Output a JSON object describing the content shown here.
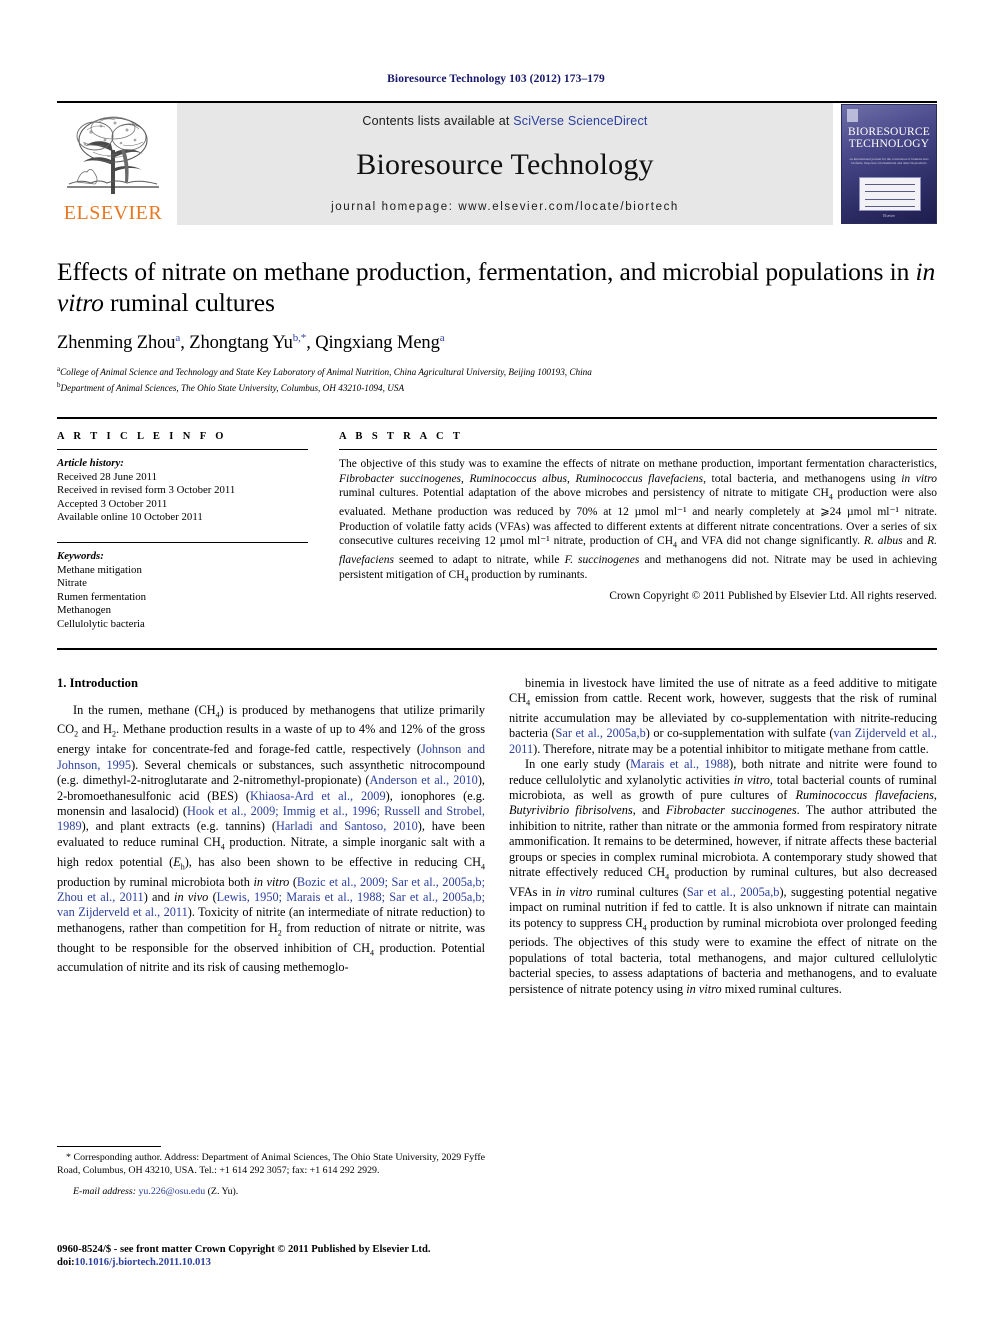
{
  "running_head": "Bioresource Technology 103 (2012) 173–179",
  "masthead": {
    "publisher_wordmark": "ELSEVIER",
    "contents_prefix": "Contents lists available at ",
    "contents_link": "SciVerse ScienceDirect",
    "journal_title": "Bioresource Technology",
    "homepage_label": "journal homepage: www.elsevier.com/locate/biortech",
    "cover_title_line1": "BIORESOURCE",
    "cover_title_line2": "TECHNOLOGY",
    "cover_subtitle": "an international journal for the conversion of biomass into biofuels, biopower, biochemicals and other bioproducts",
    "cover_footer": "Elsevier"
  },
  "article": {
    "title": "Effects of nitrate on methane production, fermentation, and microbial populations in in vitro ruminal cultures",
    "title_plain_1": "Effects of nitrate on methane production, fermentation, and microbial populations in ",
    "title_italic": "in vitro",
    "title_plain_2": " ruminal cultures",
    "authors": [
      {
        "name": "Zhenming Zhou",
        "marker": "a"
      },
      {
        "name": "Zhongtang Yu",
        "marker": "b,*"
      },
      {
        "name": "Qingxiang Meng",
        "marker": "a"
      }
    ],
    "affiliations": [
      {
        "marker": "a",
        "text": "College of Animal Science and Technology and State Key Laboratory of Animal Nutrition, China Agricultural University, Beijing 100193, China"
      },
      {
        "marker": "b",
        "text": "Department of Animal Sciences, The Ohio State University, Columbus, OH 43210-1094, USA"
      }
    ]
  },
  "article_info": {
    "heading": "A R T I C L E    I N F O",
    "history_label": "Article history:",
    "history": [
      "Received 28 June 2011",
      "Received in revised form 3 October 2011",
      "Accepted 3 October 2011",
      "Available online 10 October 2011"
    ],
    "keywords_label": "Keywords:",
    "keywords": [
      "Methane mitigation",
      "Nitrate",
      "Rumen fermentation",
      "Methanogen",
      "Cellulolytic bacteria"
    ]
  },
  "abstract": {
    "heading": "A B S T R A C T",
    "text": "The objective of this study was to examine the effects of nitrate on methane production, important fermentation characteristics, Fibrobacter succinogenes, Ruminococcus albus, Ruminococcus flavefaciens, total bacteria, and methanogens using in vitro ruminal cultures. Potential adaptation of the above microbes and persistency of nitrate to mitigate CH4 production were also evaluated. Methane production was reduced by 70% at 12 µmol ml⁻¹ and nearly completely at ⩾24 µmol ml⁻¹ nitrate. Production of volatile fatty acids (VFAs) was affected to different extents at different nitrate concentrations. Over a series of six consecutive cultures receiving 12 µmol ml⁻¹ nitrate, production of CH4 and VFA did not change significantly. R. albus and R. flavefaciens seemed to adapt to nitrate, while F. succinogenes and methanogens did not. Nitrate may be used in achieving persistent mitigation of CH4 production by ruminants.",
    "copyright": "Crown Copyright © 2011 Published by Elsevier Ltd. All rights reserved."
  },
  "introduction": {
    "heading": "1. Introduction",
    "left_paragraph_1": "In the rumen, methane (CH4) is produced by methanogens that utilize primarily CO2 and H2. Methane production results in a waste of up to 4% and 12% of the gross energy intake for concentrate-fed and forage-fed cattle, respectively (Johnson and Johnson, 1995). Several chemicals or substances, such assynthetic nitrocompound (e.g. dimethyl-2-nitroglutarate and 2-nitromethyl-propionate) (Anderson et al., 2010), 2-bromoethanesulfonic acid (BES) (Khiaosa-Ard et al., 2009), ionophores (e.g. monensin and lasalocid) (Hook et al., 2009; Immig et al., 1996; Russell and Strobel, 1989), and plant extracts (e.g. tannins) (Harladi and Santoso, 2010), have been evaluated to reduce ruminal CH4 production. Nitrate, a simple inorganic salt with a high redox potential (Eh), has also been shown to be effective in reducing CH4 production by ruminal microbiota both in vitro (Bozic et al., 2009; Sar et al., 2005a,b; Zhou et al., 2011) and in vivo (Lewis, 1950; Marais et al., 1988; Sar et al., 2005a,b; van Zijderveld et al., 2011). Toxicity of nitrite (an intermediate of nitrate reduction) to methanogens, rather than competition for H2 from reduction of nitrate or nitrite, was thought to be responsible for the observed inhibition of CH4 production. Potential accumulation of nitrite and its risk of causing methemoglo-",
    "right_paragraph_1": "binemia in livestock have limited the use of nitrate as a feed additive to mitigate CH4 emission from cattle. Recent work, however, suggests that the risk of ruminal nitrite accumulation may be alleviated by co-supplementation with nitrite-reducing bacteria (Sar et al., 2005a,b) or co-supplementation with sulfate (van Zijderveld et al., 2011). Therefore, nitrate may be a potential inhibitor to mitigate methane from cattle.",
    "right_paragraph_2": "In one early study (Marais et al., 1988), both nitrate and nitrite were found to reduce cellulolytic and xylanolytic activities in vitro, total bacterial counts of ruminal microbiota, as well as growth of pure cultures of Ruminococcus flavefaciens, Butyrivibrio fibrisolvens, and Fibrobacter succinogenes. The author attributed the inhibition to nitrite, rather than nitrate or the ammonia formed from respiratory nitrate ammonification. It remains to be determined, however, if nitrate affects these bacterial groups or species in complex ruminal microbiota. A contemporary study showed that nitrate effectively reduced CH4 production by ruminal cultures, but also decreased VFAs in in vitro ruminal cultures (Sar et al., 2005a,b), suggesting potential negative impact on ruminal nutrition if fed to cattle. It is also unknown if nitrate can maintain its potency to suppress CH4 production by ruminal microbiota over prolonged feeding periods. The objectives of this study were to examine the effect of nitrate on the populations of total bacteria, total methanogens, and major cultured cellulolytic bacterial species, to assess adaptations of bacteria and methanogens, and to evaluate persistence of nitrate potency using in vitro mixed ruminal cultures."
  },
  "footnotes": {
    "corresponding": "* Corresponding author. Address: Department of Animal Sciences, The Ohio State University, 2029 Fyffe Road, Columbus, OH 43210, USA. Tel.: +1 614 292 3057; fax: +1 614 292 2929.",
    "email_label": "E-mail address:",
    "email": "yu.226@osu.edu",
    "email_suffix": "(Z. Yu).",
    "issn_line": "0960-8524/$ - see front matter Crown Copyright © 2011 Published by Elsevier Ltd.",
    "doi_label": "doi:",
    "doi": "10.1016/j.biortech.2011.10.013"
  },
  "colors": {
    "link": "#2b3f9e",
    "citation": "#2b3f9e",
    "elsevier_orange": "#e87722",
    "running_head": "#17176b",
    "banner_bg": "#e7e7e7"
  }
}
